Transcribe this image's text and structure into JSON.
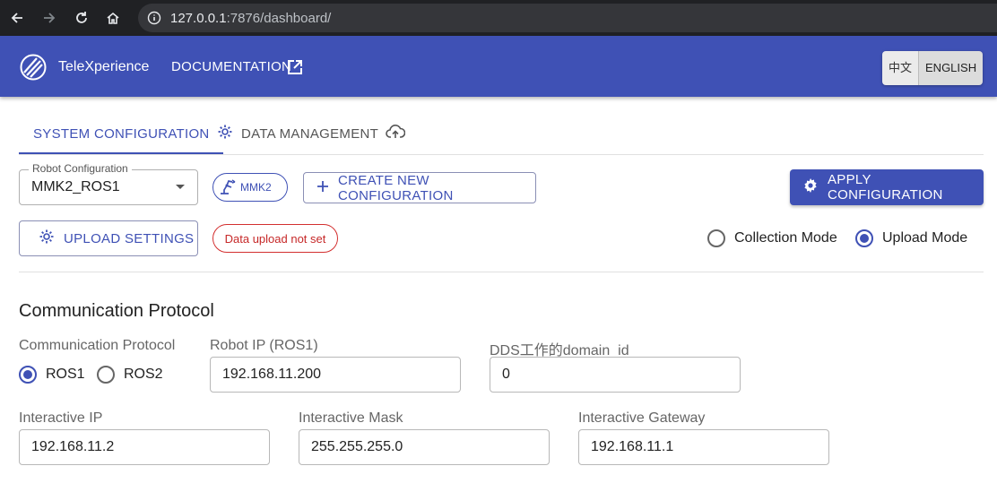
{
  "browser": {
    "url_host": "127.0.0.1",
    "url_rest": ":7876/dashboard/"
  },
  "app": {
    "brand": "TeleXperience",
    "documentation": "DOCUMENTATION",
    "lang_zh": "中文",
    "lang_en": "ENGLISH"
  },
  "tabs": [
    {
      "label": "SYSTEM CONFIGURATION",
      "icon": "gear-icon",
      "active": true
    },
    {
      "label": "DATA MANAGEMENT",
      "icon": "cloud-upload-icon",
      "active": false
    }
  ],
  "robot_config": {
    "legend": "Robot Configuration",
    "value": "MMK2_ROS1",
    "chip": "MMK2",
    "create_label": "CREATE NEW CONFIGURATION",
    "apply_label": "APPLY CONFIGURATION",
    "upload_settings_label": "UPLOAD SETTINGS",
    "upload_status": "Data upload not set"
  },
  "modes": [
    {
      "label": "Collection Mode",
      "selected": false
    },
    {
      "label": "Upload Mode",
      "selected": true
    }
  ],
  "comm": {
    "title": "Communication Protocol",
    "protocol_label": "Communication Protocol",
    "protocols": [
      {
        "label": "ROS1",
        "selected": true
      },
      {
        "label": "ROS2",
        "selected": false
      }
    ],
    "robot_ip_label": "Robot IP (ROS1)",
    "robot_ip_value": "192.168.11.200",
    "dds_label": "DDS工作的domain_id",
    "dds_value": "0",
    "interactive_ip_label": "Interactive IP",
    "interactive_ip_value": "192.168.11.2",
    "interactive_mask_label": "Interactive Mask",
    "interactive_mask_value": "255.255.255.0",
    "interactive_gateway_label": "Interactive Gateway",
    "interactive_gateway_value": "192.168.11.1"
  },
  "colors": {
    "primary": "#3f51b5",
    "error": "#d32f2f"
  }
}
